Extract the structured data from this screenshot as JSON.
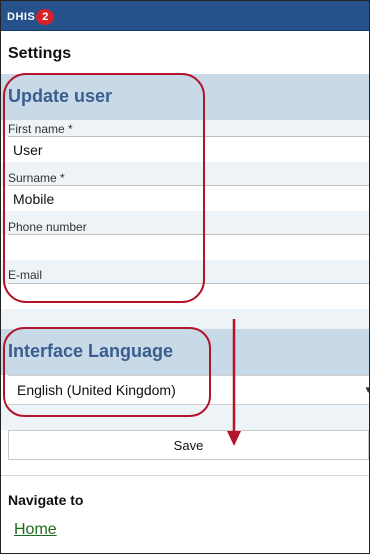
{
  "header": {
    "logo_text": "DHIS",
    "logo_badge": "2"
  },
  "page": {
    "title": "Settings"
  },
  "update_user": {
    "heading": "Update user",
    "first_name": {
      "label": "First name *",
      "value": "User"
    },
    "surname": {
      "label": "Surname *",
      "value": "Mobile"
    },
    "phone": {
      "label": "Phone number",
      "value": ""
    },
    "email": {
      "label": "E-mail",
      "value": ""
    }
  },
  "language": {
    "heading": "Interface Language",
    "selected": "English (United Kingdom)"
  },
  "actions": {
    "save_label": "Save"
  },
  "navigation": {
    "title": "Navigate to",
    "home_link": "Home"
  },
  "colors": {
    "topbar": "#27518a",
    "section_band": "#c8dae8",
    "section_text": "#3a5e8e",
    "annotation_red": "#b3142a",
    "link_green": "#1d6b1d"
  },
  "icons": {
    "dropdown": "chevron-down-icon",
    "arrow": "down-arrow-icon"
  }
}
